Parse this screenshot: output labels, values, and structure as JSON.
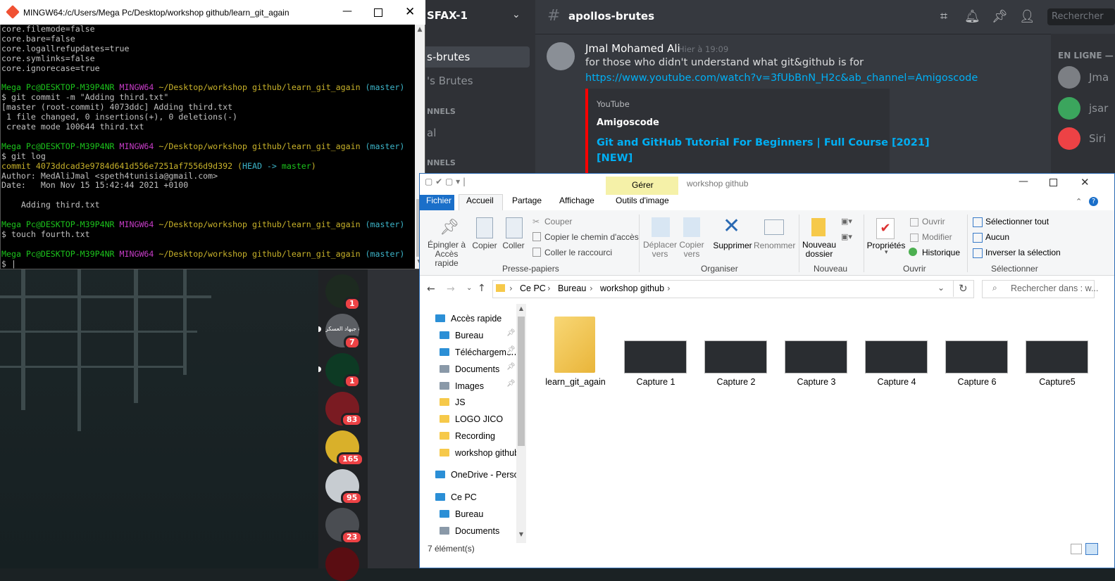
{
  "bash": {
    "title": "MINGW64:/c/Users/Mega Pc/Desktop/workshop github/learn_git_again",
    "lines": [
      [
        {
          "t": "core.filemode=false"
        }
      ],
      [
        {
          "t": "core.bare=false"
        }
      ],
      [
        {
          "t": "core.logallrefupdates=true"
        }
      ],
      [
        {
          "t": "core.symlinks=false"
        }
      ],
      [
        {
          "t": "core.ignorecase=true"
        }
      ],
      [
        {
          "t": ""
        }
      ],
      [
        {
          "t": "Mega Pc@DESKTOP-M39P4NR ",
          "c": "g"
        },
        {
          "t": "MINGW64 ",
          "c": "m"
        },
        {
          "t": "~/Desktop/workshop github/learn_git_again ",
          "c": "y"
        },
        {
          "t": "(master)",
          "c": "c"
        }
      ],
      [
        {
          "t": "$ git commit -m \"Adding third.txt\""
        }
      ],
      [
        {
          "t": "[master (root-commit) 4073ddc] Adding third.txt"
        }
      ],
      [
        {
          "t": " 1 file changed, 0 insertions(+), 0 deletions(-)"
        }
      ],
      [
        {
          "t": " create mode 100644 third.txt"
        }
      ],
      [
        {
          "t": ""
        }
      ],
      [
        {
          "t": "Mega Pc@DESKTOP-M39P4NR ",
          "c": "g"
        },
        {
          "t": "MINGW64 ",
          "c": "m"
        },
        {
          "t": "~/Desktop/workshop github/learn_git_again ",
          "c": "y"
        },
        {
          "t": "(master)",
          "c": "c"
        }
      ],
      [
        {
          "t": "$ git log"
        }
      ],
      [
        {
          "t": "commit 4073ddcad3e9784d641d556e7251af7556d9d392 (",
          "c": "y"
        },
        {
          "t": "HEAD -> ",
          "c": "c"
        },
        {
          "t": "master",
          "c": "g"
        },
        {
          "t": ")",
          "c": "y"
        }
      ],
      [
        {
          "t": "Author: MedAliJmal <speth4tunisia@gmail.com>"
        }
      ],
      [
        {
          "t": "Date:   Mon Nov 15 15:42:44 2021 +0100"
        }
      ],
      [
        {
          "t": ""
        }
      ],
      [
        {
          "t": "    Adding third.txt"
        }
      ],
      [
        {
          "t": ""
        }
      ],
      [
        {
          "t": "Mega Pc@DESKTOP-M39P4NR ",
          "c": "g"
        },
        {
          "t": "MINGW64 ",
          "c": "m"
        },
        {
          "t": "~/Desktop/workshop github/learn_git_again ",
          "c": "y"
        },
        {
          "t": "(master)",
          "c": "c"
        }
      ],
      [
        {
          "t": "$ touch fourth.txt"
        }
      ],
      [
        {
          "t": ""
        }
      ],
      [
        {
          "t": "Mega Pc@DESKTOP-M39P4NR ",
          "c": "g"
        },
        {
          "t": "MINGW64 ",
          "c": "m"
        },
        {
          "t": "~/Desktop/workshop github/learn_git_again ",
          "c": "y"
        },
        {
          "t": "(master)",
          "c": "c"
        }
      ],
      [
        {
          "t": "$ |"
        }
      ]
    ]
  },
  "discord": {
    "server_name": "SFAX-1",
    "channel_name": "apollos-brutes",
    "search_placeholder": "Rechercher",
    "channels": {
      "active": "s-brutes",
      "second": "'s Brutes",
      "section1": "NNELS",
      "item": "al",
      "section2": "NNELS"
    },
    "message": {
      "author": "Jmal Mohamed Ali",
      "timestamp": "Hier à 19:09",
      "text": "for those who didn't understand what git&github is for",
      "link": "https://www.youtube.com/watch?v=3fUbBnN_H2c&ab_channel=Amigoscode",
      "embed_provider": "YouTube",
      "embed_author": "Amigoscode",
      "embed_title_1": "Git and GitHub Tutorial For Beginners | Full Course [2021]",
      "embed_title_2": "[NEW]"
    },
    "members_header": "EN LIGNE —",
    "members": [
      "Jma",
      "jsar",
      "Siri"
    ],
    "server_badges": [
      "1",
      "7",
      "1",
      "83",
      "165",
      "95",
      "23"
    ],
    "server_text": "حيدرة جيهاد العسكر"
  },
  "explorer": {
    "title": "workshop github",
    "manage_tab": "Gérer",
    "tabs": [
      "Fichier",
      "Accueil",
      "Partage",
      "Affichage",
      "Outils d'image"
    ],
    "clipboard": {
      "pin": "Épingler à\nAccès rapide",
      "copy": "Copier",
      "paste": "Coller",
      "cut": "Couper",
      "copy_path": "Copier le chemin d'accès",
      "paste_shortcut": "Coller le raccourci",
      "group": "Presse-papiers"
    },
    "organize": {
      "move": "Déplacer\nvers",
      "copy_to": "Copier\nvers",
      "delete": "Supprimer",
      "rename": "Renommer",
      "group": "Organiser"
    },
    "new": {
      "new_folder": "Nouveau\ndossier",
      "group": "Nouveau"
    },
    "open": {
      "properties": "Propriétés",
      "open": "Ouvrir",
      "modify": "Modifier",
      "history": "Historique",
      "group": "Ouvrir"
    },
    "select": {
      "all": "Sélectionner tout",
      "none": "Aucun",
      "invert": "Inverser la sélection",
      "group": "Sélectionner"
    },
    "breadcrumb": [
      "Ce PC",
      "Bureau",
      "workshop github"
    ],
    "search_placeholder": "Rechercher dans : w...",
    "nav": [
      {
        "label": "Accès rapide",
        "icon": "star-icon",
        "indent": 0
      },
      {
        "label": "Bureau",
        "icon": "desktop-icon",
        "indent": 1,
        "pin": true
      },
      {
        "label": "Téléchargements",
        "icon": "download-icon",
        "indent": 1,
        "pin": true
      },
      {
        "label": "Documents",
        "icon": "documents-icon",
        "indent": 1,
        "pin": true
      },
      {
        "label": "Images",
        "icon": "images-icon",
        "indent": 1,
        "pin": true
      },
      {
        "label": "JS",
        "icon": "folder-icon",
        "indent": 1
      },
      {
        "label": "LOGO JICO",
        "icon": "folder-icon",
        "indent": 1
      },
      {
        "label": "Recording",
        "icon": "folder-icon",
        "indent": 1
      },
      {
        "label": "workshop github",
        "icon": "folder-icon",
        "indent": 1,
        "selected": true
      },
      {
        "label": "OneDrive - Personal",
        "icon": "onedrive-icon",
        "indent": 0
      },
      {
        "label": "Ce PC",
        "icon": "pc-icon",
        "indent": 0
      },
      {
        "label": "Bureau",
        "icon": "desktop-icon",
        "indent": 1
      },
      {
        "label": "Documents",
        "icon": "documents-icon",
        "indent": 1
      }
    ],
    "files": [
      "learn_git_again",
      "Capture 1",
      "Capture 2",
      "Capture 3",
      "Capture 4",
      "Capture 6",
      "Capture5"
    ],
    "status": "7 élément(s)"
  }
}
